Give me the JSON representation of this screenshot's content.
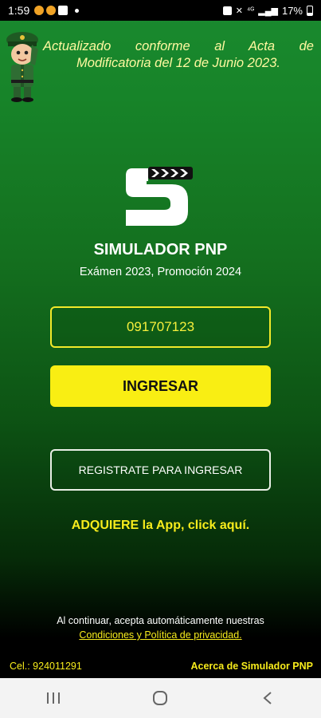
{
  "status_bar": {
    "time": "1:59",
    "battery": "17%",
    "icons": [
      "notification-icon",
      "notification-icon",
      "app-icon",
      "alarm-icon",
      "mute-icon",
      "wifi-icon",
      "signal-icon",
      "battery-icon"
    ]
  },
  "header": {
    "notice_line1": "Actualizado conforme al Acta de",
    "notice_line2": "Modificatoria del 12 de Junio 2023."
  },
  "app": {
    "title": "SIMULADOR PNP",
    "subtitle": "Exámen 2023, Promoción 2024"
  },
  "form": {
    "code_value": "091707123",
    "login_label": "INGRESAR",
    "register_label": "REGISTRATE PARA INGRESAR"
  },
  "links": {
    "buy_app": "ADQUIERE la App, click aquí."
  },
  "terms": {
    "notice": "Al continuar, acepta automáticamente nuestras",
    "link": "Condiciones y Política de privacidad."
  },
  "footer": {
    "phone": "Cel.: 924011291",
    "about": "Acerca de Simulador PNP"
  },
  "colors": {
    "accent": "#f9ee13",
    "background_top": "#1a8a2f",
    "background_bottom": "#000000"
  }
}
